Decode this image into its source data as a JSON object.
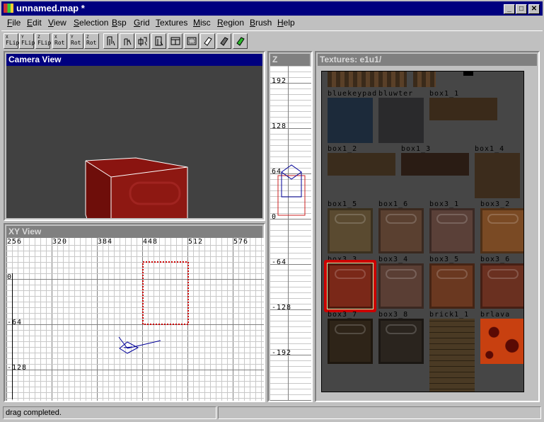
{
  "window": {
    "title": "unnamed.map *",
    "minimize": "_",
    "maximize": "□",
    "close": "✕"
  },
  "menu": [
    "File",
    "Edit",
    "View",
    "Selection",
    "Bsp",
    "Grid",
    "Textures",
    "Misc",
    "Region",
    "Brush",
    "Help"
  ],
  "toolbar": [
    {
      "axis": "X",
      "label": "FLip",
      "name": "x-flip-button"
    },
    {
      "axis": "Y",
      "label": "FLip",
      "name": "y-flip-button"
    },
    {
      "axis": "Z",
      "label": "FLip",
      "name": "z-flip-button"
    },
    {
      "axis": "X",
      "label": "Rot",
      "name": "x-rotate-button"
    },
    {
      "axis": "Y",
      "label": "Rot",
      "name": "y-rotate-button"
    },
    {
      "axis": "Z",
      "label": "Rot",
      "name": "z-rotate-button"
    }
  ],
  "toolbar_icons": [
    "select-complete-tall-icon",
    "select-touching-icon",
    "select-partial-tall-icon",
    "select-inside-icon",
    "csg-subtract-icon",
    "csg-merge-icon",
    "clipper-icon",
    "clipper-dark-icon",
    "clipper-green-icon"
  ],
  "camera": {
    "title": "Camera View"
  },
  "xy": {
    "title": "XY View",
    "x_ticks": [
      "256",
      "320",
      "384",
      "448",
      "512",
      "576"
    ],
    "y_ticks": [
      "0",
      "-64",
      "-128"
    ]
  },
  "z": {
    "title": "Z",
    "ticks": [
      "192",
      "128",
      "64",
      "0",
      "-64",
      "-128",
      "-192"
    ]
  },
  "textures": {
    "title": "Textures: e1u1/",
    "items": [
      {
        "name": "bluekeypad",
        "color": "#1c2a3a"
      },
      {
        "name": "bluwter",
        "color": "#2a2a2c"
      },
      {
        "name": "box1_1",
        "color": "#3a2a1a"
      },
      {
        "name": "box1_2",
        "color": "#3a2c1c"
      },
      {
        "name": "box1_3",
        "color": "#2a1c14"
      },
      {
        "name": "box1_4",
        "color": "#3c2c1c"
      },
      {
        "name": "box1_5",
        "color": "#5a4a30"
      },
      {
        "name": "box1_6",
        "color": "#5a4030"
      },
      {
        "name": "box3_1",
        "color": "#5a4038"
      },
      {
        "name": "box3_2",
        "color": "#7a4a24"
      },
      {
        "name": "box3_3",
        "color": "#7a2818",
        "selected": true
      },
      {
        "name": "box3_4",
        "color": "#5a3e34"
      },
      {
        "name": "box3_5",
        "color": "#6a3820"
      },
      {
        "name": "box3_6",
        "color": "#6a3020"
      },
      {
        "name": "box3_7",
        "color": "#2e2418"
      },
      {
        "name": "box3_8",
        "color": "#2a241e"
      },
      {
        "name": "brick1_1",
        "color": "#4a3a24"
      },
      {
        "name": "brlava",
        "color": "#c84010"
      }
    ]
  },
  "status": {
    "message": "drag completed."
  },
  "colors": {
    "titlebar": "#00007f",
    "selection": "#cc0000",
    "brush": "#000099"
  }
}
